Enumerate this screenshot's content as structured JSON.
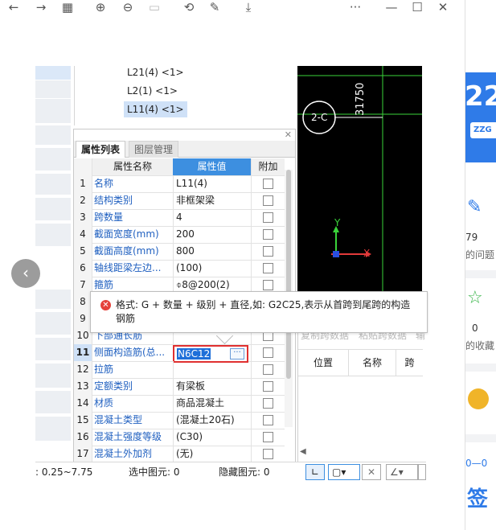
{
  "tree": {
    "items": [
      "L21(4) <1>",
      "L2(1) <1>",
      "L11(4) <1>"
    ]
  },
  "tabs": {
    "props": "属性列表",
    "layers": "图层管理"
  },
  "table": {
    "headers": {
      "name": "属性名称",
      "value": "属性值",
      "add": "附加"
    },
    "rows": [
      {
        "n": "1",
        "name": "名称",
        "value": "L11(4)"
      },
      {
        "n": "2",
        "name": "结构类别",
        "value": "非框架梁"
      },
      {
        "n": "3",
        "name": "跨数量",
        "value": "4"
      },
      {
        "n": "4",
        "name": "截面宽度(mm)",
        "value": "200"
      },
      {
        "n": "5",
        "name": "截面高度(mm)",
        "value": "800"
      },
      {
        "n": "6",
        "name": "轴线距梁左边...",
        "value": "(100)"
      },
      {
        "n": "7",
        "name": "箍筋",
        "value": "⌽8@200(2)"
      },
      {
        "n": "8",
        "name": "",
        "value": ""
      },
      {
        "n": "9",
        "name": "",
        "value": ""
      },
      {
        "n": "10",
        "name": "下部通长筋",
        "value": ""
      },
      {
        "n": "11",
        "name": "侧面构造筋(总...",
        "value": "N6C12"
      },
      {
        "n": "12",
        "name": "拉筋",
        "value": ""
      },
      {
        "n": "13",
        "name": "定额类别",
        "value": "有梁板"
      },
      {
        "n": "14",
        "name": "材质",
        "value": "商品混凝土"
      },
      {
        "n": "15",
        "name": "混凝土类型",
        "value": "(混凝土20石)"
      },
      {
        "n": "16",
        "name": "混凝土强度等级",
        "value": "(C30)"
      },
      {
        "n": "17",
        "name": "混凝土外加剂",
        "value": "(无)"
      }
    ]
  },
  "tooltip": {
    "text": "格式: G + 数量 + 级别 + 直径,如: G2C25,表示从首跨到尾跨的构造钢筋"
  },
  "cad": {
    "axis_label": "2-C",
    "dimension": "31750",
    "x_label": "X",
    "y_label": "Y"
  },
  "grid_panel": {
    "faded_tabs": [
      "复制跨数据",
      "粘贴跨数据",
      "输"
    ],
    "headers": [
      "位置",
      "名称",
      "跨"
    ]
  },
  "status": {
    "range": ": 0.25~7.75",
    "selected": "选中图元: 0",
    "hidden": "隐藏图元: 0"
  },
  "side": {
    "count_1": "79",
    "label_1": "的问题",
    "count_2": "0",
    "label_2": "的收藏",
    "big_num": "22",
    "badge": "ZZG",
    "sign": "签"
  },
  "colors": {
    "accent": "#3d8fe0",
    "error": "#e5413a",
    "link": "#2060c0"
  }
}
